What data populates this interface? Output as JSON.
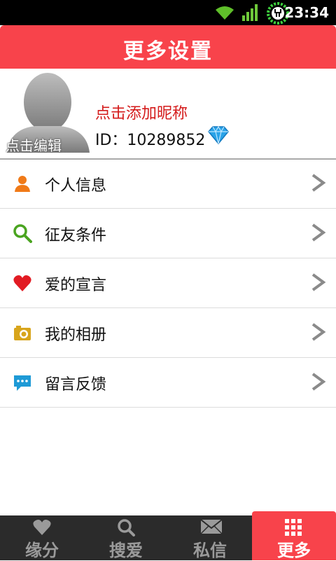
{
  "status_bar": {
    "time": "23:34"
  },
  "header": {
    "title": "更多设置"
  },
  "profile": {
    "avatar_edit_label": "点击编辑",
    "nickname_prompt": "点击添加昵称",
    "id_text": "ID：10289852"
  },
  "menu": {
    "items": [
      {
        "label": "个人信息",
        "icon": "person-icon"
      },
      {
        "label": "征友条件",
        "icon": "magnifier-icon"
      },
      {
        "label": "爱的宣言",
        "icon": "heart-icon"
      },
      {
        "label": "我的相册",
        "icon": "camera-icon"
      },
      {
        "label": "留言反馈",
        "icon": "chat-bubble-icon"
      }
    ]
  },
  "bottom_nav": {
    "tabs": [
      {
        "label": "缘分",
        "icon": "heart-icon"
      },
      {
        "label": "搜爱",
        "icon": "search-icon"
      },
      {
        "label": "私信",
        "icon": "envelope-icon"
      },
      {
        "label": "更多",
        "icon": "grid-icon",
        "active": true
      }
    ]
  },
  "colors": {
    "accent": "#f8434b",
    "nickname": "#d41a1a",
    "nav_bg": "#2b2b2b"
  }
}
